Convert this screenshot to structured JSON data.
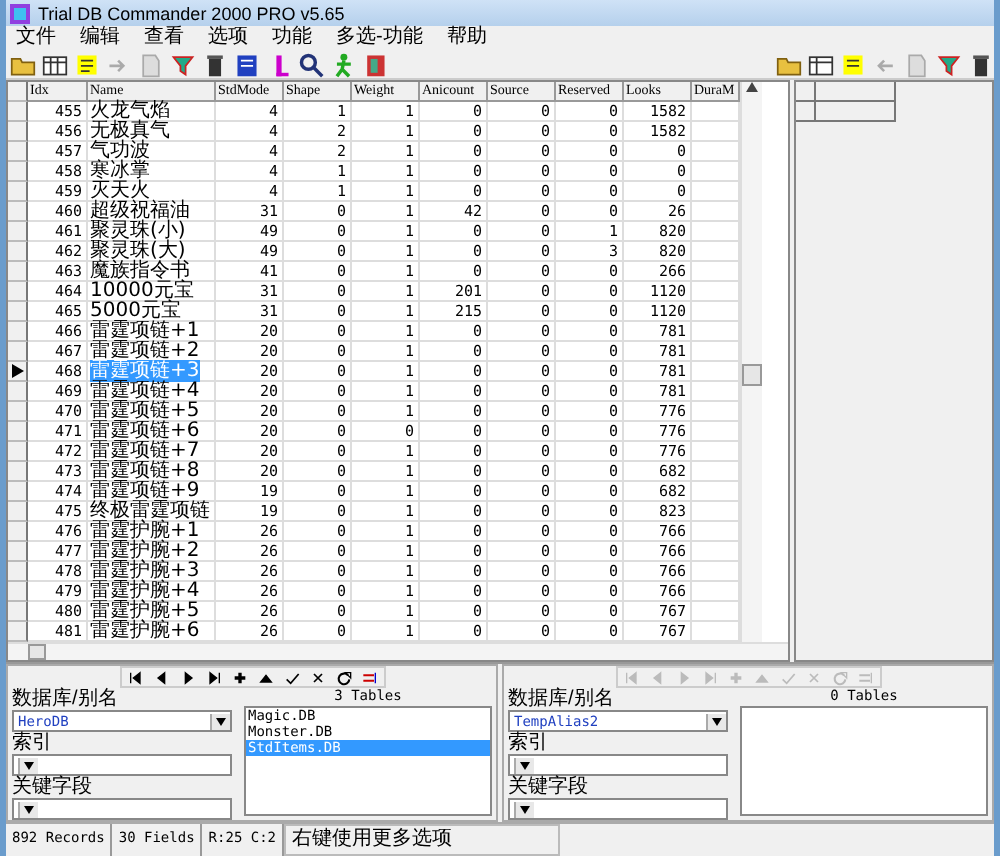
{
  "window": {
    "title": "Trial DB Commander 2000 PRO v5.65"
  },
  "menu": [
    "文件",
    "编辑",
    "查看",
    "选项",
    "功能",
    "多选-功能",
    "帮助"
  ],
  "table": {
    "columns": [
      "Idx",
      "Name",
      "StdMode",
      "Shape",
      "Weight",
      "Anicount",
      "Source",
      "Reserved",
      "Looks",
      "DuraM"
    ],
    "rows": [
      {
        "cells": [
          "455",
          "火龙气焰",
          "4",
          "1",
          "1",
          "0",
          "0",
          "0",
          "1582"
        ],
        "selected": false
      },
      {
        "cells": [
          "456",
          "无极真气",
          "4",
          "2",
          "1",
          "0",
          "0",
          "0",
          "1582"
        ],
        "selected": false
      },
      {
        "cells": [
          "457",
          "气功波",
          "4",
          "2",
          "1",
          "0",
          "0",
          "0",
          "0"
        ],
        "selected": false
      },
      {
        "cells": [
          "458",
          "寒冰掌",
          "4",
          "1",
          "1",
          "0",
          "0",
          "0",
          "0"
        ],
        "selected": false
      },
      {
        "cells": [
          "459",
          "灭天火",
          "4",
          "1",
          "1",
          "0",
          "0",
          "0",
          "0"
        ],
        "selected": false
      },
      {
        "cells": [
          "460",
          "超级祝福油",
          "31",
          "0",
          "1",
          "42",
          "0",
          "0",
          "26"
        ],
        "selected": false
      },
      {
        "cells": [
          "461",
          "聚灵珠(小)",
          "49",
          "0",
          "1",
          "0",
          "0",
          "1",
          "820"
        ],
        "selected": false
      },
      {
        "cells": [
          "462",
          "聚灵珠(大)",
          "49",
          "0",
          "1",
          "0",
          "0",
          "3",
          "820"
        ],
        "selected": false
      },
      {
        "cells": [
          "463",
          "魔族指令书",
          "41",
          "0",
          "1",
          "0",
          "0",
          "0",
          "266"
        ],
        "selected": false
      },
      {
        "cells": [
          "464",
          "10000元宝",
          "31",
          "0",
          "1",
          "201",
          "0",
          "0",
          "1120"
        ],
        "selected": false
      },
      {
        "cells": [
          "465",
          "5000元宝",
          "31",
          "0",
          "1",
          "215",
          "0",
          "0",
          "1120"
        ],
        "selected": false
      },
      {
        "cells": [
          "466",
          "雷霆项链+1",
          "20",
          "0",
          "1",
          "0",
          "0",
          "0",
          "781"
        ],
        "selected": false
      },
      {
        "cells": [
          "467",
          "雷霆项链+2",
          "20",
          "0",
          "1",
          "0",
          "0",
          "0",
          "781"
        ],
        "selected": false
      },
      {
        "cells": [
          "468",
          "雷霆项链+3",
          "20",
          "0",
          "1",
          "0",
          "0",
          "0",
          "781"
        ],
        "selected": true
      },
      {
        "cells": [
          "469",
          "雷霆项链+4",
          "20",
          "0",
          "1",
          "0",
          "0",
          "0",
          "781"
        ],
        "selected": false
      },
      {
        "cells": [
          "470",
          "雷霆项链+5",
          "20",
          "0",
          "1",
          "0",
          "0",
          "0",
          "776"
        ],
        "selected": false
      },
      {
        "cells": [
          "471",
          "雷霆项链+6",
          "20",
          "0",
          "0",
          "0",
          "0",
          "0",
          "776"
        ],
        "selected": false
      },
      {
        "cells": [
          "472",
          "雷霆项链+7",
          "20",
          "0",
          "1",
          "0",
          "0",
          "0",
          "776"
        ],
        "selected": false
      },
      {
        "cells": [
          "473",
          "雷霆项链+8",
          "20",
          "0",
          "1",
          "0",
          "0",
          "0",
          "682"
        ],
        "selected": false
      },
      {
        "cells": [
          "474",
          "雷霆项链+9",
          "19",
          "0",
          "1",
          "0",
          "0",
          "0",
          "682"
        ],
        "selected": false
      },
      {
        "cells": [
          "475",
          "终极雷霆项链",
          "19",
          "0",
          "1",
          "0",
          "0",
          "0",
          "823"
        ],
        "selected": false
      },
      {
        "cells": [
          "476",
          "雷霆护腕+1",
          "26",
          "0",
          "1",
          "0",
          "0",
          "0",
          "766"
        ],
        "selected": false
      },
      {
        "cells": [
          "477",
          "雷霆护腕+2",
          "26",
          "0",
          "1",
          "0",
          "0",
          "0",
          "766"
        ],
        "selected": false
      },
      {
        "cells": [
          "478",
          "雷霆护腕+3",
          "26",
          "0",
          "1",
          "0",
          "0",
          "0",
          "766"
        ],
        "selected": false
      },
      {
        "cells": [
          "479",
          "雷霆护腕+4",
          "26",
          "0",
          "1",
          "0",
          "0",
          "0",
          "766"
        ],
        "selected": false
      },
      {
        "cells": [
          "480",
          "雷霆护腕+5",
          "26",
          "0",
          "1",
          "0",
          "0",
          "0",
          "767"
        ],
        "selected": false
      },
      {
        "cells": [
          "481",
          "雷霆护腕+6",
          "26",
          "0",
          "1",
          "0",
          "0",
          "0",
          "767"
        ],
        "selected": false
      }
    ]
  },
  "panels": [
    {
      "navigator": {
        "disabled": false
      },
      "alias_label": "数据库/别名",
      "alias": "HeroDB",
      "index_label": "索引",
      "key_label": "关键字段",
      "tables_title": "3 Tables",
      "tables": [
        {
          "name": "Magic.DB",
          "selected": false
        },
        {
          "name": "Monster.DB",
          "selected": false
        },
        {
          "name": "StdItems.DB",
          "selected": true
        }
      ]
    },
    {
      "navigator": {
        "disabled": true
      },
      "alias_label": "数据库/别名",
      "alias": "TempAlias2",
      "index_label": "索引",
      "key_label": "关键字段",
      "tables_title": "0 Tables"
    }
  ],
  "status_bar": {
    "records": "892 Records",
    "fields": "30 Fields",
    "position": "R:25 C:2",
    "hint": "右键使用更多选项"
  }
}
